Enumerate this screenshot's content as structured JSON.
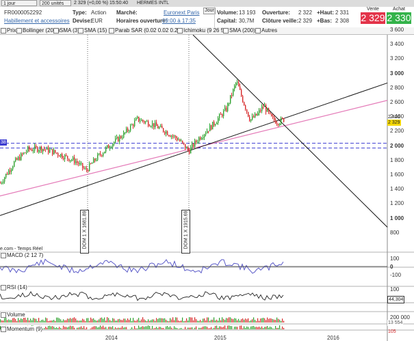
{
  "toolbar": {
    "period": "1 jour",
    "units": "200 unités",
    "quote_line": "2 329 (+0,00 %) 15:50:40",
    "instrument": "HERMES INTL"
  },
  "instrument": {
    "isin": "FR0000052292",
    "sector_link": "Habillement et accessoires",
    "type_label": "Type:",
    "type_value": "Action",
    "currency_label": "Devise:",
    "currency_value": "EUR",
    "market_label": "Marché:",
    "market_value": "Euronext Paris",
    "hours_label": "Horaires ouverture:",
    "hours_value": "09:00 à 17:35",
    "day_tab": "Jour",
    "volume_label": "Volume:",
    "volume_value": "13 193",
    "capital_label": "Capital:",
    "capital_value": "30,7M",
    "open_label": "Ouverture:",
    "open_value": "2 322",
    "prev_close_label": "Clôture veille:",
    "prev_close_value": "2 329",
    "high_label": "+Haut:",
    "high_value": "2 331",
    "low_label": "+Bas:",
    "low_value": "2 308",
    "sell_label": "Vente",
    "sell_value": "2 329",
    "buy_label": "Achat",
    "buy_value": "2 330",
    "sell_color": "#e3344a",
    "buy_color": "#34b34a"
  },
  "indicators": [
    {
      "label": "Prix",
      "checked": true
    },
    {
      "label": "Bollinger (20 2)",
      "checked": false
    },
    {
      "label": "SMA (3)",
      "checked": false
    },
    {
      "label": "SMA (15)",
      "checked": false
    },
    {
      "label": "Parab SAR (0.02 0.02 0.2)",
      "checked": false
    },
    {
      "label": "Ichimoku (9 26 52)",
      "checked": false
    },
    {
      "label": "SMA (200)",
      "checked": false
    },
    {
      "label": "Autres",
      "checked": false
    }
  ],
  "price_axis": [
    "3 600",
    "3 400",
    "3 200",
    "3 000",
    "2 800",
    "2 600",
    "2 400",
    "2 200",
    "2 000",
    "1 800",
    "1 600",
    "1 400",
    "1 200",
    "1 000",
    "800"
  ],
  "price_tag": "2 329",
  "price_tag_high": "2 420",
  "level_tag": "38",
  "annotations": [
    "DOM 1 X 1681.89",
    "DOM 1 X 1915.69"
  ],
  "source": "e.com - Temps Réel",
  "panels": {
    "macd": {
      "label": "MACD (2 12 7)",
      "axis": [
        "100",
        "0",
        "-100"
      ]
    },
    "rsi": {
      "label": "RSI (14)",
      "axis": [
        "100"
      ],
      "value": "44,304"
    },
    "volume": {
      "label": "Volume",
      "axis": [
        "200 000"
      ],
      "value": "13 554"
    },
    "momentum": {
      "label": "Momentum (9)",
      "value": "105"
    }
  },
  "bottom_axis": [
    "2014",
    "2015",
    "2016"
  ],
  "colors": {
    "up": "#2ca02c",
    "down": "#d62728",
    "trend": "#e47ab8",
    "macd": "#5a5ac8",
    "level": "#3b3bd1"
  }
}
